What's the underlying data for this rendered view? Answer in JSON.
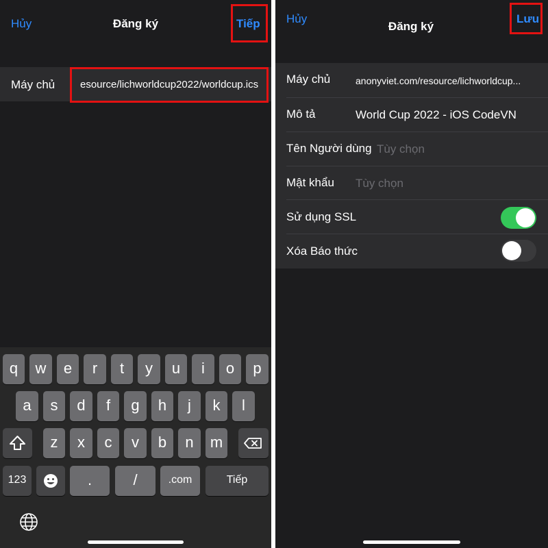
{
  "left": {
    "cancel": "Hủy",
    "title": "Đăng ký",
    "next": "Tiếp",
    "server_label": "Máy chủ",
    "server_value": "esource/lichworldcup2022/worldcup.ics"
  },
  "keyboard": {
    "row1": [
      "q",
      "w",
      "e",
      "r",
      "t",
      "y",
      "u",
      "i",
      "o",
      "p"
    ],
    "row2": [
      "a",
      "s",
      "d",
      "f",
      "g",
      "h",
      "j",
      "k",
      "l"
    ],
    "row3": [
      "z",
      "x",
      "c",
      "v",
      "b",
      "n",
      "m"
    ],
    "num_label": "123",
    "dot": ".",
    "slash": "/",
    "com": ".com",
    "next": "Tiếp"
  },
  "right": {
    "cancel": "Hủy",
    "title": "Đăng ký",
    "save": "Lưu",
    "rows": [
      {
        "label": "Máy chủ",
        "value": "anonyviet.com/resource/lichworldcup..."
      },
      {
        "label": "Mô tả",
        "value": "World Cup 2022 - iOS CodeVN"
      },
      {
        "label": "Tên Người dùng",
        "placeholder": "Tùy chọn"
      },
      {
        "label": "Mật khẩu",
        "placeholder": "Tùy chọn"
      },
      {
        "label": "Sử dụng SSL",
        "toggle": true
      },
      {
        "label": "Xóa Báo thức",
        "toggle": false
      }
    ]
  },
  "colors": {
    "accent": "#2f8bff",
    "toggle_on": "#34c759",
    "toggle_off": "#3a3a3c",
    "highlight": "#e31212"
  }
}
